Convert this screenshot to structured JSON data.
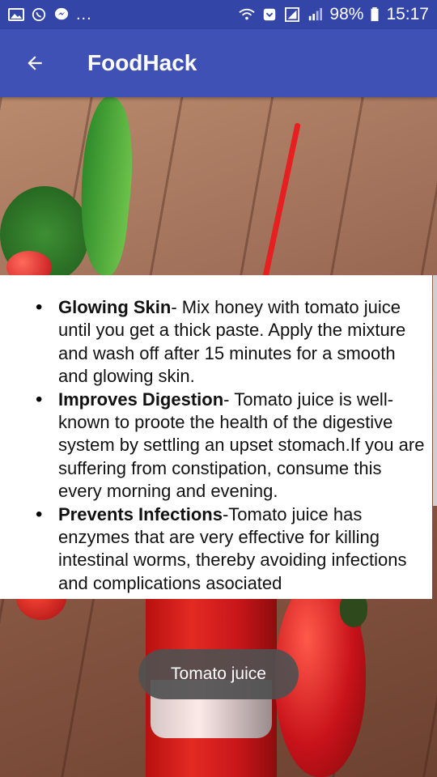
{
  "status_bar": {
    "battery": "98%",
    "time": "15:17",
    "dots": "...",
    "left_icons": [
      "image-icon",
      "whatsapp-icon",
      "messenger-icon"
    ],
    "right_icons": [
      "wifi-icon",
      "data-saver-icon",
      "signal-icon",
      "signal-icon",
      "battery-icon"
    ]
  },
  "app_bar": {
    "title": "FoodHack",
    "back_icon": "arrow-left-icon",
    "color": "#3f51b5"
  },
  "content": {
    "items": [
      {
        "title": "Glowing Skin",
        "text": "- Mix honey with tomato juice until you get a thick paste. Apply the mixture and wash off after 15 minutes for a smooth and glowing skin."
      },
      {
        "title": "Improves Digestion",
        "text": "- Tomato juice is well-known to proote the health of the digestive system by settling an upset stomach.If you are suffering from constipation, consume this every morning and evening."
      },
      {
        "title": "Prevents Infections",
        "text": "-Tomato juice has enzymes that are very effective for killing intestinal worms, thereby avoiding infections and complications asociated"
      }
    ]
  },
  "toast": {
    "text": "Tomato juice"
  }
}
